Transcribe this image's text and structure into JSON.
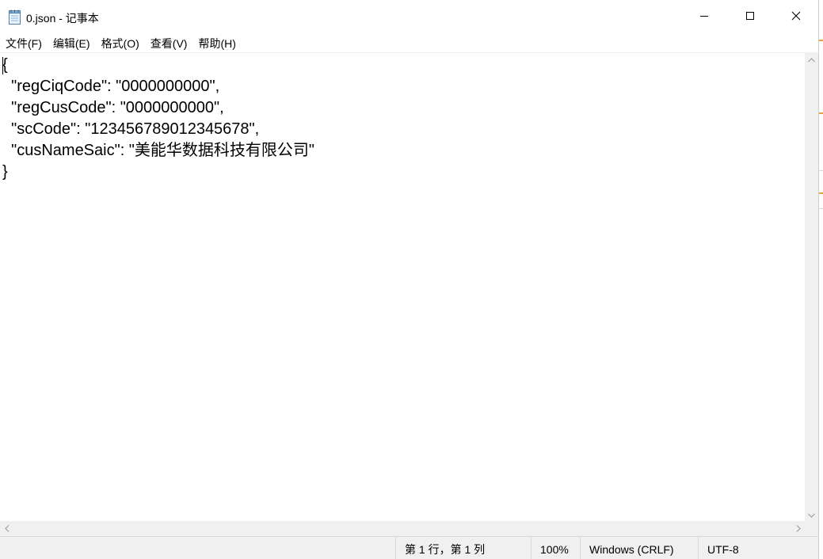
{
  "window": {
    "title": "0.json - 记事本",
    "icon": "notepad-icon",
    "controls": {
      "minimize_icon": "minimize-icon",
      "maximize_icon": "maximize-icon",
      "close_icon": "close-icon"
    }
  },
  "menu": {
    "items": [
      {
        "label": "文件(F)"
      },
      {
        "label": "编辑(E)"
      },
      {
        "label": "格式(O)"
      },
      {
        "label": "查看(V)"
      },
      {
        "label": "帮助(H)"
      }
    ]
  },
  "editor": {
    "content": "{\n  \"regCiqCode\": \"0000000000\",\n  \"regCusCode\": \"0000000000\",\n  \"scCode\": \"123456789012345678\",\n  \"cusNameSaic\": \"美能华数据科技有限公司\"\n}"
  },
  "statusbar": {
    "position": "第 1 行，第 1 列",
    "zoom": "100%",
    "line_ending": "Windows (CRLF)",
    "encoding": "UTF-8"
  },
  "colors": {
    "background": "#ffffff",
    "chrome": "#f0f0f0",
    "text": "#000000",
    "accent_background_window": "#e8a23c"
  }
}
